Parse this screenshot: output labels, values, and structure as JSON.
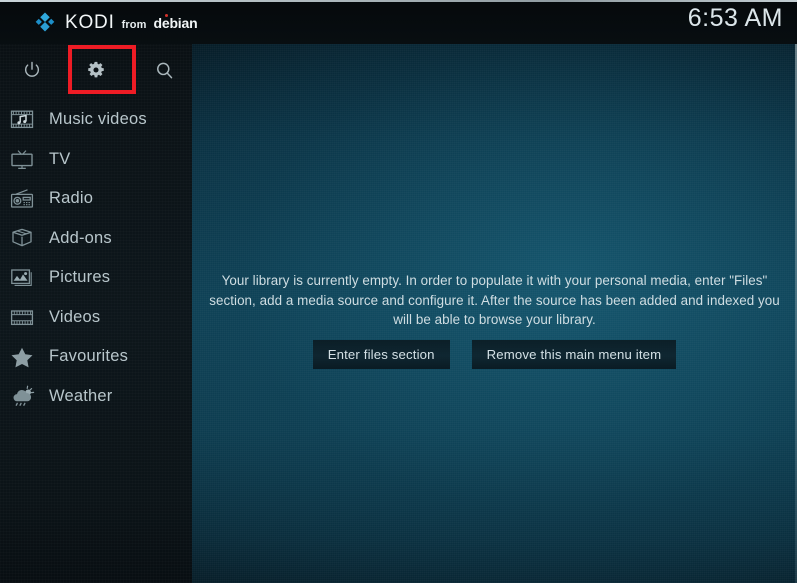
{
  "app": {
    "brand_kodi": "KODI",
    "brand_from": "from",
    "brand_distro": "debian",
    "logo_icon": "kodi-diamond-logo-icon",
    "accent_blue": "#3eb4e0",
    "highlight_red": "#ee1c25",
    "debian_red": "#d2332c"
  },
  "statusbar": {
    "clock": "6:53 AM"
  },
  "toolbar": {
    "items": [
      {
        "name": "power-icon",
        "label": "Power"
      },
      {
        "name": "gear-icon",
        "label": "Settings"
      },
      {
        "name": "search-icon",
        "label": "Search"
      }
    ],
    "highlighted": "gear-icon"
  },
  "sidebar": {
    "items": [
      {
        "label": "Music videos",
        "icon": "music-videos-icon"
      },
      {
        "label": "TV",
        "icon": "tv-icon"
      },
      {
        "label": "Radio",
        "icon": "radio-icon"
      },
      {
        "label": "Add-ons",
        "icon": "addons-box-icon"
      },
      {
        "label": "Pictures",
        "icon": "pictures-icon"
      },
      {
        "label": "Videos",
        "icon": "videos-filmstrip-icon"
      },
      {
        "label": "Favourites",
        "icon": "star-icon"
      },
      {
        "label": "Weather",
        "icon": "weather-cloud-rain-icon"
      }
    ]
  },
  "main": {
    "empty_message": "Your library is currently empty. In order to populate it with your personal media, enter \"Files\" section, add a media source and configure it. After the source has been added and indexed you will be able to browse your library.",
    "buttons": [
      {
        "label": "Enter files section"
      },
      {
        "label": "Remove this main menu item"
      }
    ]
  }
}
